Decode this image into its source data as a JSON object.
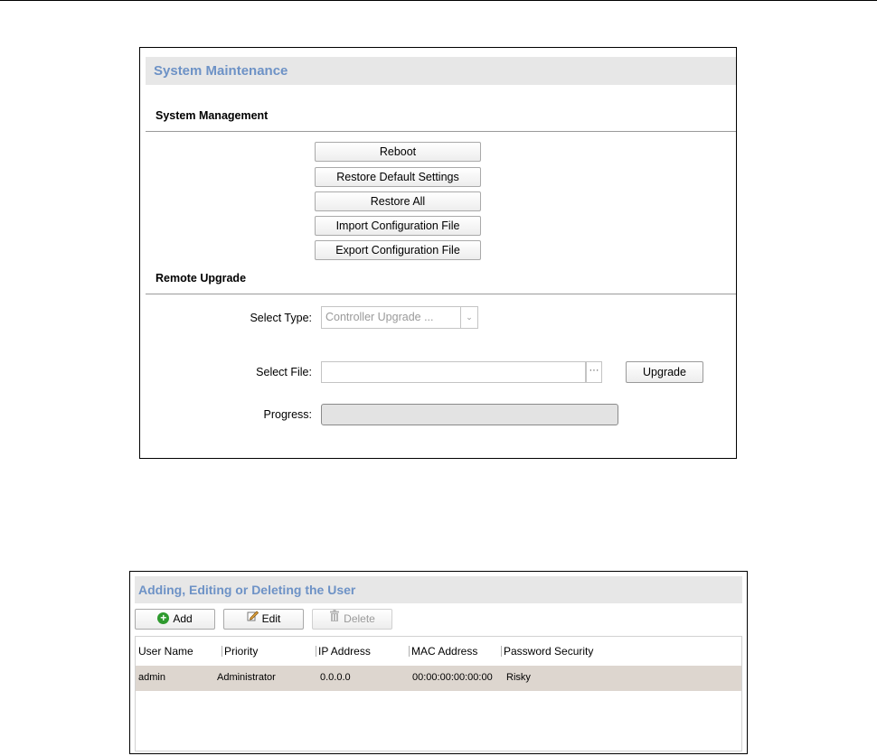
{
  "system_maintenance": {
    "title": "System Maintenance",
    "system_management": {
      "heading": "System Management",
      "buttons": [
        "Reboot",
        "Restore Default Settings",
        "Restore All",
        "Import Configuration File",
        "Export Configuration File"
      ]
    },
    "remote_upgrade": {
      "heading": "Remote Upgrade",
      "select_type_label": "Select Type:",
      "select_type_value": "Controller Upgrade ...",
      "select_file_label": "Select File:",
      "select_file_value": "",
      "browse_label": "···",
      "upgrade_label": "Upgrade",
      "progress_label": "Progress:",
      "progress_value": 0
    }
  },
  "users": {
    "title": "Adding, Editing or Deleting the User",
    "toolbar": {
      "add": "Add",
      "edit": "Edit",
      "delete": "Delete"
    },
    "columns": [
      "User Name",
      "Priority",
      "IP Address",
      "MAC Address",
      "Password Security"
    ],
    "rows": [
      [
        "admin",
        "Administrator",
        "0.0.0.0",
        "00:00:00:00:00:00",
        "Risky"
      ]
    ]
  },
  "icons": {
    "select_arrow": "chevron-down-icon",
    "add": "add-circle-icon",
    "edit": "edit-pencil-icon",
    "delete": "trash-icon"
  },
  "colors": {
    "title_text": "#6d92c6",
    "title_bar": "#e7e7e7",
    "selected_row": "#ddd6cf",
    "add_icon": "#2e9a2e"
  }
}
